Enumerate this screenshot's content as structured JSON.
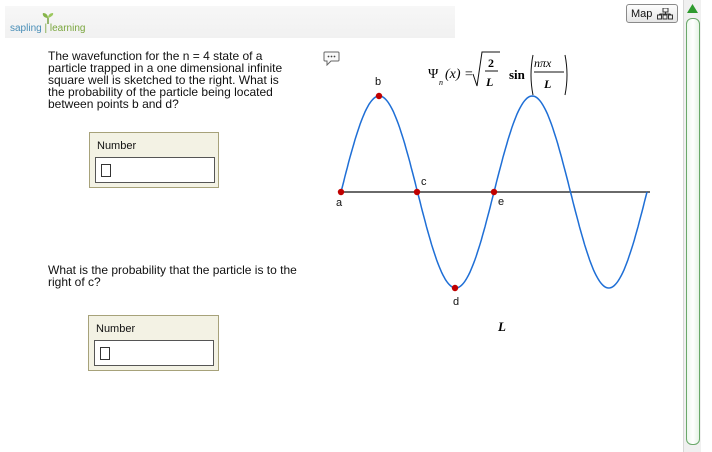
{
  "brand": {
    "part1": "sapling",
    "part2": "learning"
  },
  "toolbar": {
    "map_label": "Map"
  },
  "questions": [
    {
      "text": "The wavefunction for the n = 4 state of a particle trapped in a one dimensional infinite square well is sketched to the right. What is the probability of the particle being located between points b and d?",
      "answer_label": "Number",
      "answer_value": ""
    },
    {
      "text": "What is the probability that the particle is to the right of c?",
      "answer_label": "Number",
      "answer_value": ""
    }
  ],
  "figure": {
    "points": [
      "a",
      "b",
      "c",
      "d",
      "e"
    ],
    "axis_label": "L",
    "formula": {
      "psi": "Ψ",
      "sub": "n",
      "arg": "(x) =",
      "num": "2",
      "den": "L",
      "fn": "sin",
      "inner_num": "nπx",
      "inner_den": "L"
    },
    "colors": {
      "curve": "#1f6fd6",
      "point": "#c00000"
    }
  }
}
